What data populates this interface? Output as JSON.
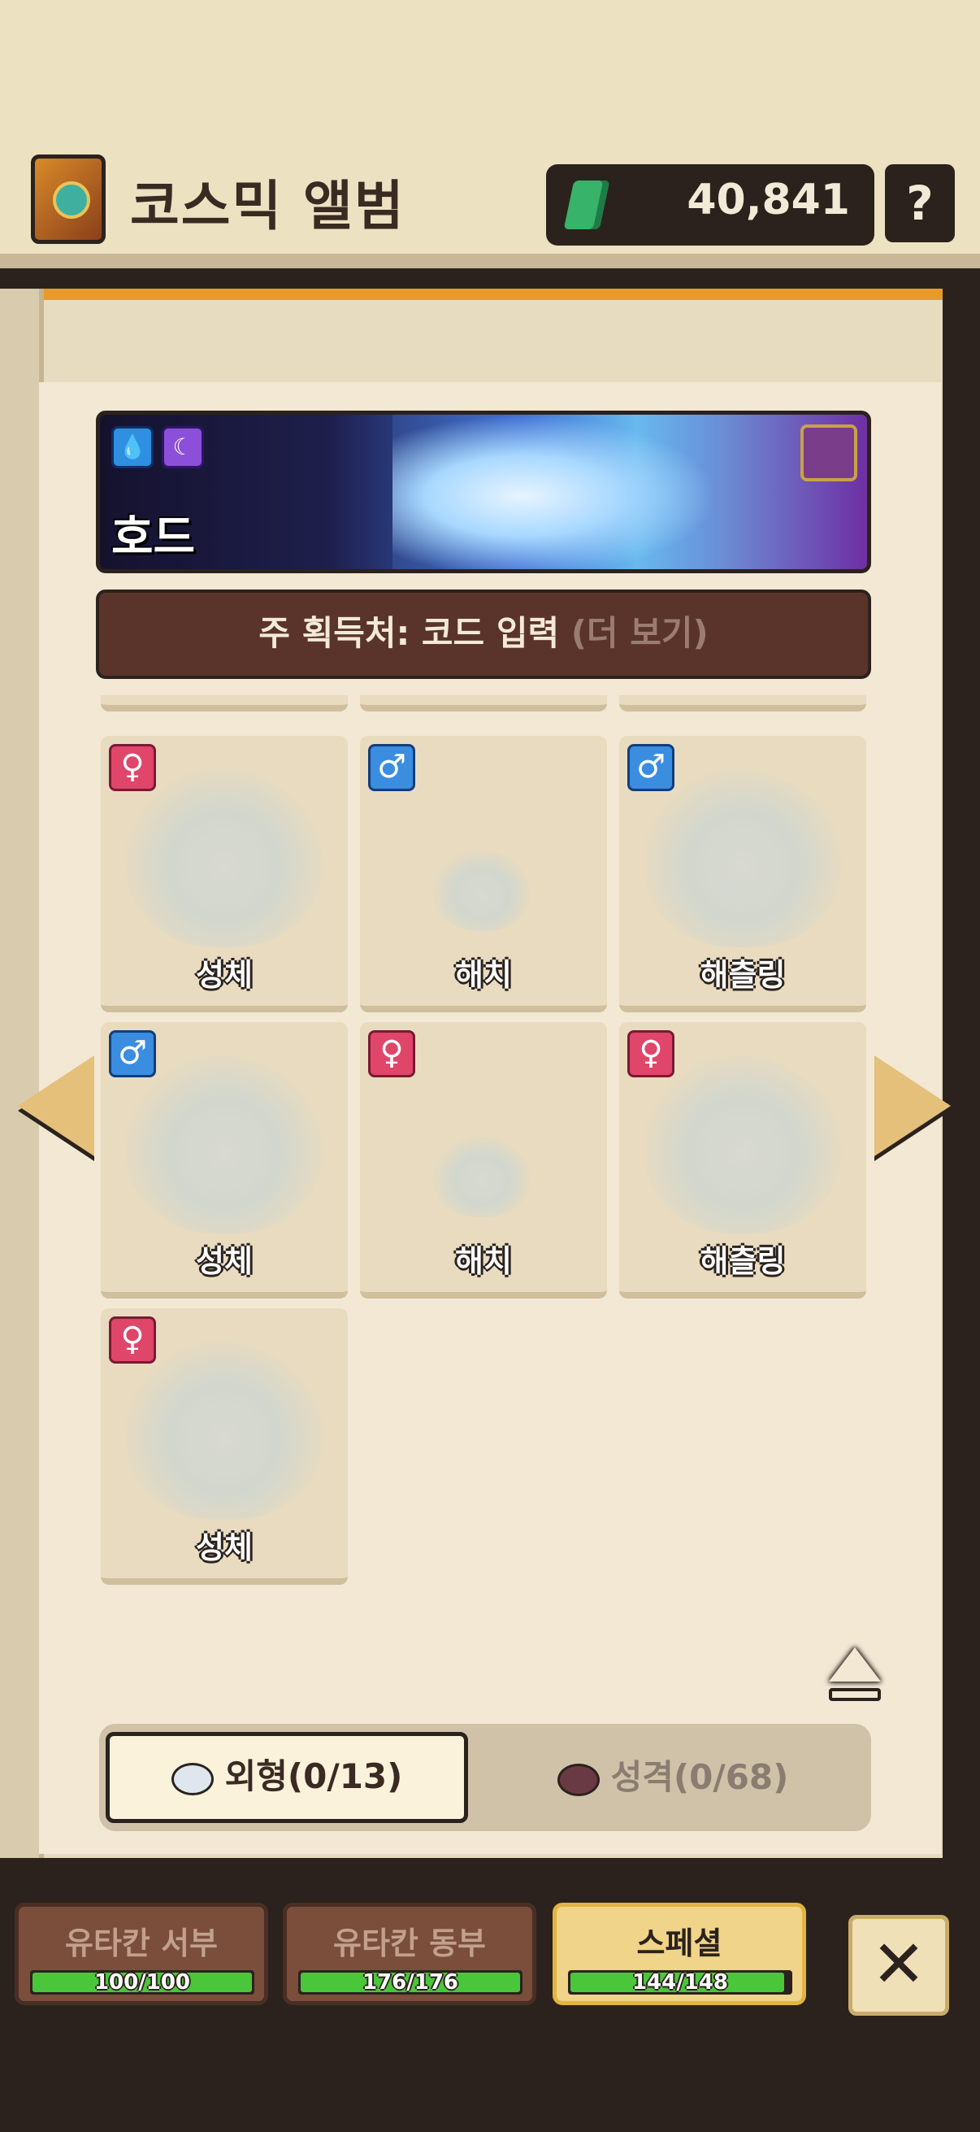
{
  "header": {
    "title": "코스믹 앨범",
    "currency_value": "40,841",
    "help_label": "?"
  },
  "banner": {
    "dragon_name": "호드",
    "elements": [
      "water-icon",
      "moon-icon"
    ]
  },
  "source": {
    "label": "주 획득처: 코드 입력",
    "more": "(더 보기)"
  },
  "cards": [
    {
      "name": "성체",
      "gender": "female"
    },
    {
      "name": "해치",
      "gender": "male"
    },
    {
      "name": "해츨링",
      "gender": "male"
    },
    {
      "name": "성체",
      "gender": "male"
    },
    {
      "name": "해치",
      "gender": "female"
    },
    {
      "name": "해츨링",
      "gender": "female"
    },
    {
      "name": "성체",
      "gender": "female"
    }
  ],
  "tabs": {
    "appearance": "외형(0/13)",
    "personality": "성격(0/68)"
  },
  "regions": [
    {
      "label": "유타칸 서부",
      "progress": "100/100",
      "fraction": 1.0
    },
    {
      "label": "유타칸 동부",
      "progress": "176/176",
      "fraction": 1.0
    },
    {
      "label": "스페셜",
      "progress": "144/148",
      "fraction": 0.973
    }
  ],
  "colors": {
    "accent_orange": "#e99a2c",
    "page_bg": "#f2e8d4",
    "progress_green": "#4ac63a",
    "female": "#e0466a",
    "male": "#3b8de0"
  }
}
